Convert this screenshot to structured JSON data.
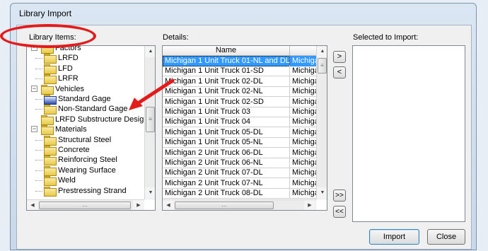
{
  "window": {
    "title": "Library Import"
  },
  "library_items_label": "Library Items:",
  "details_label": "Details:",
  "selected_label": "Selected to Import:",
  "tree": [
    {
      "text": "Factors",
      "level": 0,
      "expander": "−"
    },
    {
      "text": "LRFD",
      "level": 1
    },
    {
      "text": "LFD",
      "level": 1
    },
    {
      "text": "LRFR",
      "level": 1
    },
    {
      "text": "Vehicles",
      "level": 0,
      "expander": "−"
    },
    {
      "text": "Standard Gage",
      "level": 1,
      "selected": true
    },
    {
      "text": "Non-Standard Gage",
      "level": 1
    },
    {
      "text": "LRFD Substructure Design",
      "level": 0
    },
    {
      "text": "Materials",
      "level": 0,
      "expander": "−"
    },
    {
      "text": "Structural Steel",
      "level": 1
    },
    {
      "text": "Concrete",
      "level": 1
    },
    {
      "text": "Reinforcing Steel",
      "level": 1
    },
    {
      "text": "Wearing Surface",
      "level": 1
    },
    {
      "text": "Weld",
      "level": 1
    },
    {
      "text": "Prestressing Strand",
      "level": 1
    }
  ],
  "details": {
    "columns": [
      "Name",
      ""
    ],
    "rows": [
      [
        "Michigan 1 Unit Truck 01-NL and DL",
        "Michigan"
      ],
      [
        "Michigan 1 Unit Truck 01-SD",
        "Michigan"
      ],
      [
        "Michigan 1 Unit Truck 02-DL",
        "Michigan"
      ],
      [
        "Michigan 1 Unit Truck 02-NL",
        "Michigan"
      ],
      [
        "Michigan 1 Unit Truck 02-SD",
        "Michigan"
      ],
      [
        "Michigan 1 Unit Truck 03",
        "Michigan"
      ],
      [
        "Michigan 1 Unit Truck 04",
        "Michigan"
      ],
      [
        "Michigan 1 Unit Truck 05-DL",
        "Michigan"
      ],
      [
        "Michigan 1 Unit Truck 05-NL",
        "Michigan"
      ],
      [
        "Michigan 2 Unit Truck 06-DL",
        "Michigan"
      ],
      [
        "Michigan 2 Unit Truck 06-NL",
        "Michigan"
      ],
      [
        "Michigan 2 Unit Truck 07-DL",
        "Michigan"
      ],
      [
        "Michigan 2 Unit Truck 07-NL",
        "Michigan"
      ],
      [
        "Michigan 2 Unit Truck 08-DL",
        "Michigan"
      ]
    ]
  },
  "buttons": {
    "add": ">",
    "remove": "<",
    "add_all": ">>",
    "remove_all": "<<",
    "import": "Import",
    "close": "Close"
  },
  "scroll_glyphs": {
    "up": "▲",
    "down": "▼",
    "left": "◀",
    "right": "▶",
    "grip": "≡"
  },
  "annotation_color": "#e31b1b"
}
